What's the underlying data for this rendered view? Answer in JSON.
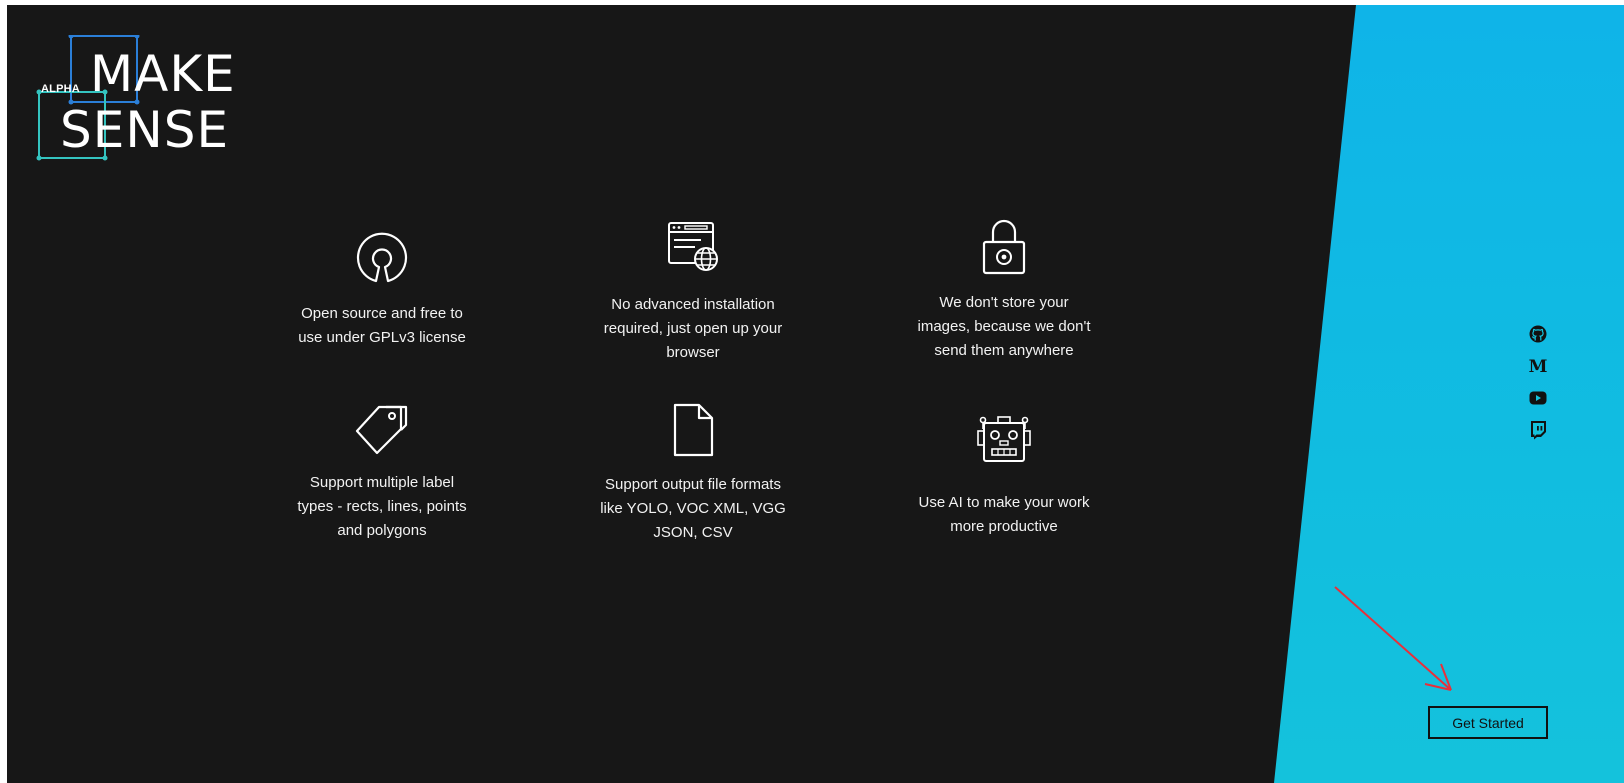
{
  "logo": {
    "badge": "ALPHA",
    "line1": "MAKE",
    "line2": "SENSE"
  },
  "features": [
    {
      "icon": "open-source-icon",
      "text_lines": [
        "Open source and free to",
        "use under GPLv3 license"
      ]
    },
    {
      "icon": "browser-globe-icon",
      "text_lines": [
        "No advanced installation",
        "required, just open up your",
        "browser"
      ]
    },
    {
      "icon": "lock-icon",
      "text_lines": [
        "We don't store your",
        "images, because we don't",
        "send them anywhere"
      ]
    },
    {
      "icon": "tags-icon",
      "text_lines": [
        "Support multiple label",
        "types - rects, lines, points",
        "and polygons"
      ]
    },
    {
      "icon": "file-icon",
      "text_lines": [
        "Support output file formats",
        "like YOLO, VOC XML, VGG",
        "JSON, CSV"
      ]
    },
    {
      "icon": "robot-icon",
      "text_lines": [
        "Use AI to make your work",
        "more productive"
      ]
    }
  ],
  "socials": [
    "github-icon",
    "medium-icon",
    "youtube-icon",
    "twitch-icon"
  ],
  "cta": {
    "label": "Get Started"
  },
  "colors": {
    "background": "#171717",
    "accent_blue": "#11bde0",
    "annotation_arrow": "#e8303a"
  }
}
